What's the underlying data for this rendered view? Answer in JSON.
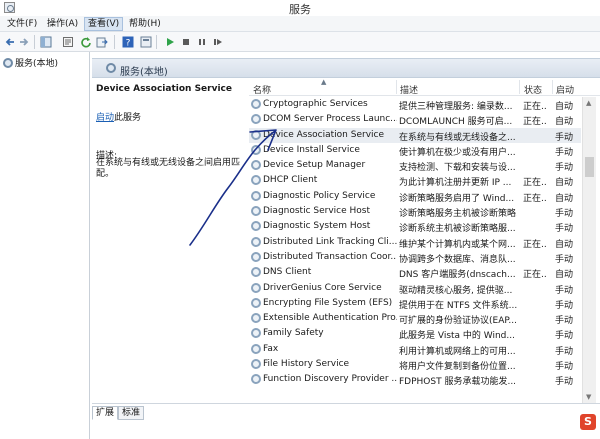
{
  "window": {
    "title": "服务"
  },
  "menu": [
    {
      "label": "文件(F)"
    },
    {
      "label": "操作(A)"
    },
    {
      "label": "查看(V)"
    },
    {
      "label": "帮助(H)"
    }
  ],
  "tree": {
    "item": "服务(本地)"
  },
  "main": {
    "header": "服务(本地)",
    "selected_service": "Device Association Service",
    "start_link": "启动",
    "start_suffix": "此服务",
    "desc_label": "描述:",
    "desc_text": "在系统与有线或无线设备之间启用匹配。"
  },
  "columns": {
    "name": "名称",
    "desc": "描述",
    "status": "状态",
    "start": "启动"
  },
  "services": [
    {
      "name": "Cryptographic Services",
      "desc": "提供三种管理服务: 编录数...",
      "status": "正在...",
      "start": "自动"
    },
    {
      "name": "DCOM Server Process Launc...",
      "desc": "DCOMLAUNCH 服务可启...",
      "status": "正在...",
      "start": "自动"
    },
    {
      "name": "Device Association Service",
      "desc": "在系统与有线或无线设备之...",
      "status": "",
      "start": "手动"
    },
    {
      "name": "Device Install Service",
      "desc": "使计算机在极少或没有用户...",
      "status": "",
      "start": "手动"
    },
    {
      "name": "Device Setup Manager",
      "desc": "支持检测、下载和安装与设...",
      "status": "",
      "start": "手动"
    },
    {
      "name": "DHCP Client",
      "desc": "为此计算机注册并更新 IP ...",
      "status": "正在...",
      "start": "自动"
    },
    {
      "name": "Diagnostic Policy Service",
      "desc": "诊断策略服务启用了 Wind...",
      "status": "正在...",
      "start": "自动"
    },
    {
      "name": "Diagnostic Service Host",
      "desc": "诊断策略服务主机被诊断策略...",
      "status": "",
      "start": "手动"
    },
    {
      "name": "Diagnostic System Host",
      "desc": "诊断系统主机被诊断策略服...",
      "status": "",
      "start": "手动"
    },
    {
      "name": "Distributed Link Tracking Cli...",
      "desc": "维护某个计算机内或某个网...",
      "status": "正在...",
      "start": "自动"
    },
    {
      "name": "Distributed Transaction Coor...",
      "desc": "协调跨多个数据库、消息队...",
      "status": "",
      "start": "手动"
    },
    {
      "name": "DNS Client",
      "desc": "DNS 客户端服务(dnscach...",
      "status": "正在...",
      "start": "自动"
    },
    {
      "name": "DriverGenius Core Service",
      "desc": "驱动精灵核心服务, 提供驱...",
      "status": "",
      "start": "手动"
    },
    {
      "name": "Encrypting File System (EFS)",
      "desc": "提供用于在 NTFS 文件系统...",
      "status": "",
      "start": "手动"
    },
    {
      "name": "Extensible Authentication Pro...",
      "desc": "可扩展的身份验证协议(EAP...",
      "status": "",
      "start": "手动"
    },
    {
      "name": "Family Safety",
      "desc": "此服务是 Vista 中的 Wind...",
      "status": "",
      "start": "手动"
    },
    {
      "name": "Fax",
      "desc": "利用计算机或网络上的可用...",
      "status": "",
      "start": "手动"
    },
    {
      "name": "File History Service",
      "desc": "将用户文件复制到备份位置...",
      "status": "",
      "start": "手动"
    },
    {
      "name": "Function Discovery Provider ...",
      "desc": "FDPHOST 服务承载功能发...",
      "status": "",
      "start": "手动"
    }
  ],
  "tabs": [
    {
      "label": "扩展"
    },
    {
      "label": "标准"
    }
  ],
  "colors": {
    "accent": "#1a5fb4",
    "header_bg": "#d6dfea",
    "annotation_stroke": "#1a2f8a",
    "watermark": "#e0442b"
  }
}
